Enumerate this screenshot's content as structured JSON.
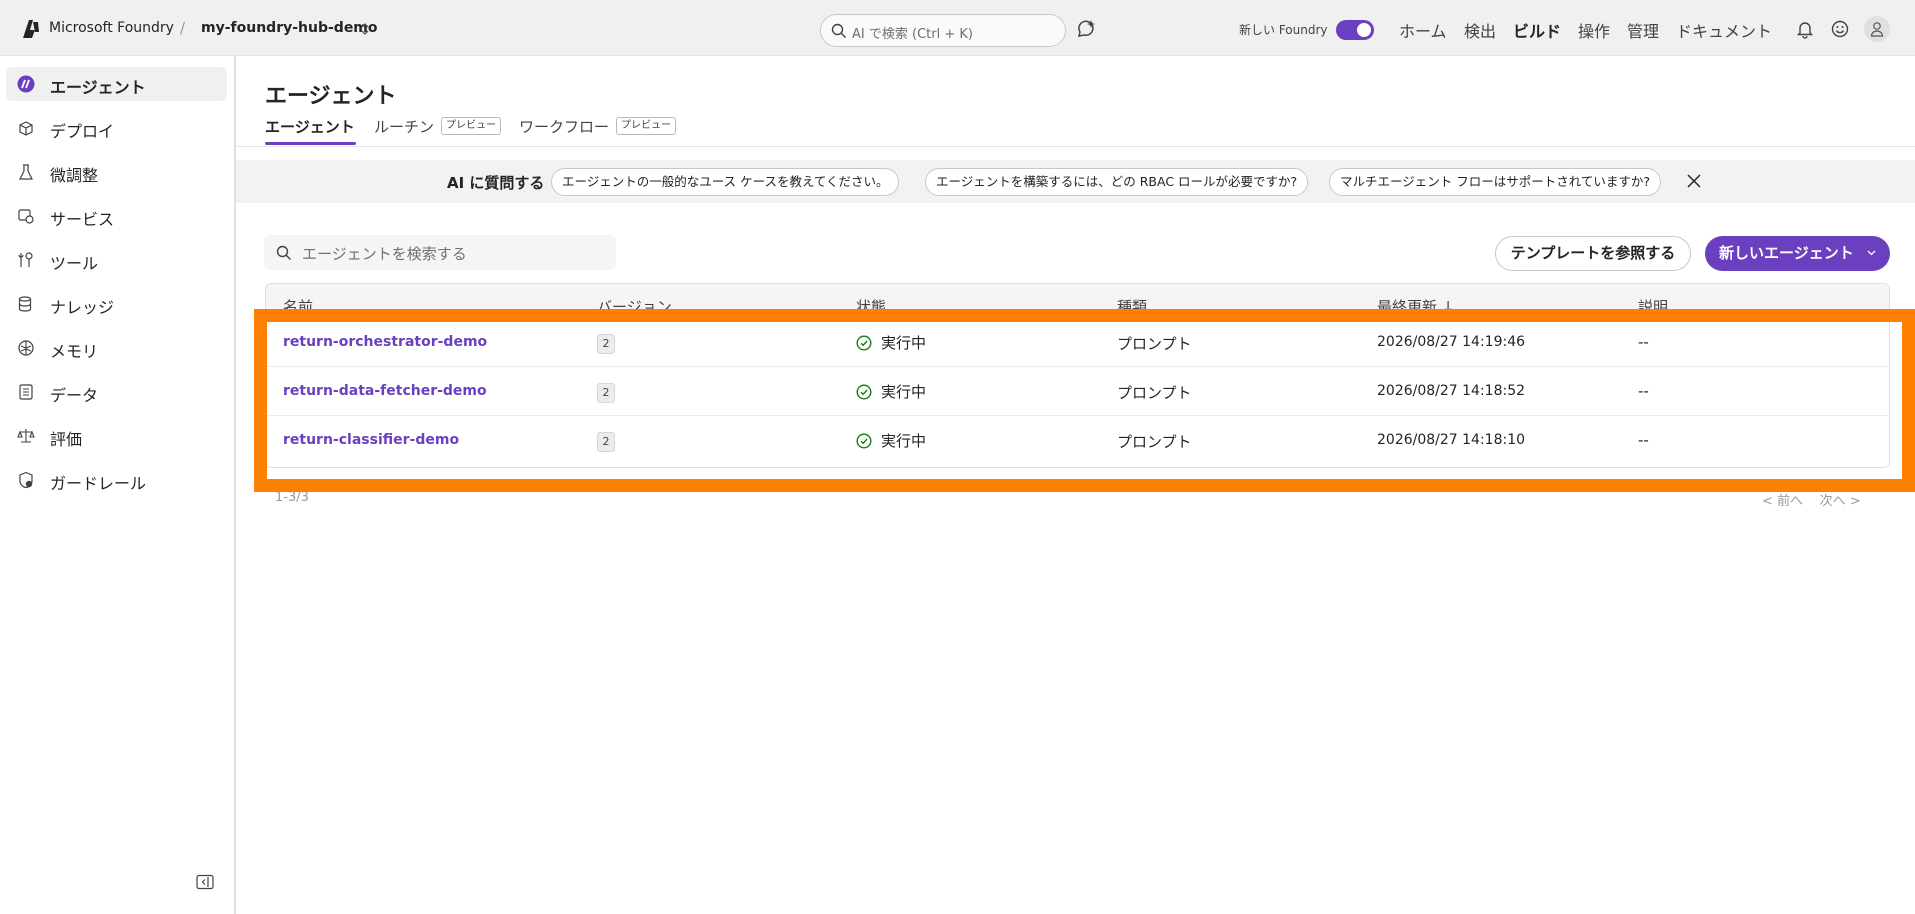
{
  "header": {
    "app_name": "Microsoft Foundry",
    "separator": "/",
    "project": "my-foundry-hub-demo",
    "search_placeholder": "AI で検索 (Ctrl + K)",
    "new_foundry_label": "新しい Foundry",
    "new_foundry_enabled": true,
    "nav": [
      "ホーム",
      "検出",
      "ビルド",
      "操作",
      "管理",
      "ドキュメント"
    ],
    "active_nav": "ビルド"
  },
  "sidebar": {
    "items": [
      {
        "label": "エージェント",
        "icon": "agent-icon"
      },
      {
        "label": "デプロイ",
        "icon": "cube-icon"
      },
      {
        "label": "微調整",
        "icon": "flask-icon"
      },
      {
        "label": "サービス",
        "icon": "services-icon"
      },
      {
        "label": "ツール",
        "icon": "wrench-icon"
      },
      {
        "label": "ナレッジ",
        "icon": "database-icon"
      },
      {
        "label": "メモリ",
        "icon": "brain-icon"
      },
      {
        "label": "データ",
        "icon": "document-icon"
      },
      {
        "label": "評価",
        "icon": "scale-icon"
      },
      {
        "label": "ガードレール",
        "icon": "shield-icon"
      }
    ],
    "active": "エージェント"
  },
  "main": {
    "title": "エージェント",
    "tabs": [
      {
        "label": "エージェント",
        "badge": ""
      },
      {
        "label": "ルーチン",
        "badge": "プレビュー"
      },
      {
        "label": "ワークフロー",
        "badge": "プレビュー"
      }
    ],
    "ask_ai": {
      "label": "AI に質問する",
      "suggestions": [
        "エージェントの一般的なユース ケースを教えてください。",
        "エージェントを構築するには、どの RBAC ロールが必要ですか?",
        "マルチエージェント フローはサポートされていますか?"
      ]
    },
    "search_placeholder": "エージェントを検索する",
    "template_button": "テンプレートを参照する",
    "new_agent_button": "新しいエージェント",
    "table": {
      "columns": [
        "名前",
        "バージョン",
        "状態",
        "種類",
        "最終更新 ↓",
        "説明"
      ],
      "rows": [
        {
          "name": "return-orchestrator-demo",
          "version": "2",
          "status": "実行中",
          "type": "プロンプト",
          "updated": "2026/08/27 14:19:46",
          "description": "--"
        },
        {
          "name": "return-data-fetcher-demo",
          "version": "2",
          "status": "実行中",
          "type": "プロンプト",
          "updated": "2026/08/27 14:18:52",
          "description": "--"
        },
        {
          "name": "return-classifier-demo",
          "version": "2",
          "status": "実行中",
          "type": "プロンプト",
          "updated": "2026/08/27 14:18:10",
          "description": "--"
        }
      ]
    },
    "pager": {
      "summary": "1-3/3",
      "prev": "< 前へ",
      "next": "次へ >"
    }
  },
  "colors": {
    "accent": "#6a40c0",
    "highlight": "#ff7f00",
    "success": "#107c10"
  }
}
